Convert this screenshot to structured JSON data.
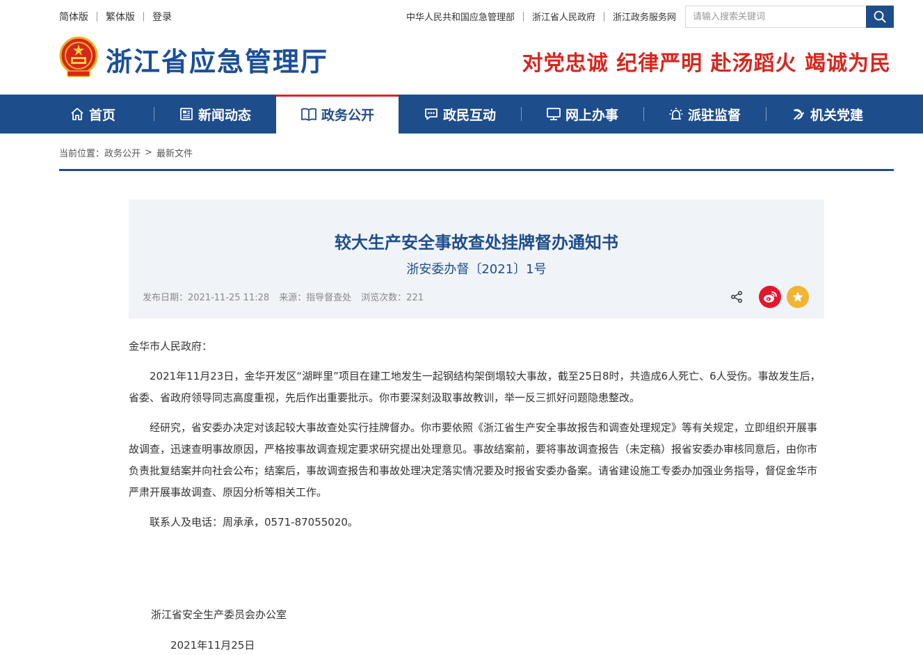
{
  "topbar": {
    "lang_links": [
      "简体版",
      "繁体版",
      "登录"
    ],
    "external_links": [
      "中华人民共和国应急管理部",
      "浙江省人民政府",
      "浙江政务服务网"
    ],
    "search_placeholder": "请输入搜索关键词"
  },
  "header": {
    "site_title": "浙江省应急管理厅",
    "slogan": "对党忠诚 纪律严明 赴汤蹈火 竭诚为民"
  },
  "nav": {
    "items": [
      {
        "label": "首页",
        "icon": "home-icon"
      },
      {
        "label": "新闻动态",
        "icon": "newspaper-icon"
      },
      {
        "label": "政务公开",
        "icon": "book-icon"
      },
      {
        "label": "政民互动",
        "icon": "chat-icon"
      },
      {
        "label": "网上办事",
        "icon": "monitor-icon"
      },
      {
        "label": "派驻监督",
        "icon": "alarm-light-icon"
      },
      {
        "label": "机关党建",
        "icon": "party-emblem-icon"
      }
    ],
    "active_index": 2
  },
  "breadcrumb": {
    "prefix": "当前位置：",
    "items": [
      "政务公开",
      "最新文件"
    ],
    "separator": ">"
  },
  "article": {
    "title": "较大生产安全事故查处挂牌督办通知书",
    "doc_number": "浙安委办督〔2021〕1号",
    "meta": {
      "date": "发布日期：2021-11-25 11:28",
      "source": "来源：指导督查处",
      "views": "浏览次数：221"
    },
    "salutation": "金华市人民政府：",
    "paragraphs": [
      "2021年11月23日，金华开发区“湖畔里”项目在建工地发生一起钢结构架倒塌较大事故，截至25日8时，共造成6人死亡、6人受伤。事故发生后，省委、省政府领导同志高度重视，先后作出重要批示。你市要深刻汲取事故教训，举一反三抓好问题隐患整改。",
      "经研究，省安委办决定对该起较大事故查处实行挂牌督办。你市要依照《浙江省生产安全事故报告和调查处理规定》等有关规定，立即组织开展事故调查，迅速查明事故原因，严格按事故调查规定要求研究提出处理意见。事故结案前，要将事故调查报告（未定稿）报省安委办审核同意后，由你市负责批复结案并向社会公布；结案后，事故调查报告和事故处理决定落实情况要及时报省安委办备案。请省建设施工专委办加强业务指导，督促金华市严肃开展事故调查、原因分析等相关工作。",
      "联系人及电话：周承承，0571-87055020。"
    ],
    "signature_org": "浙江省安全生产委员会办公室",
    "signature_date": "2021年11月25日"
  },
  "colors": {
    "brand_blue": "#1e4d8c",
    "accent_red": "#d7261e",
    "weibo_red": "#e6162d",
    "favorite_yellow": "#f2b531"
  }
}
